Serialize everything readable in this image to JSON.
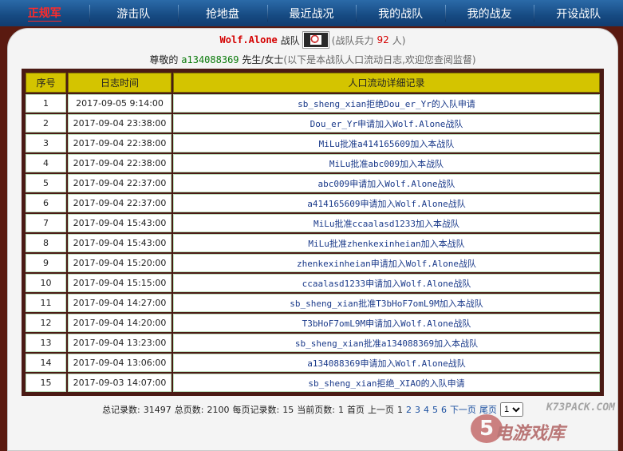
{
  "nav": {
    "items": [
      "正规军",
      "游击队",
      "抢地盘",
      "最近战况",
      "我的战队",
      "我的战友",
      "开设战队"
    ]
  },
  "header": {
    "team_name": "Wolf.Alone",
    "team_suffix": "战队",
    "power_label_pre": "(战队兵力",
    "power_value": "92",
    "power_label_post": "人)"
  },
  "intro": {
    "greeting": "尊敬的",
    "user": "a134088369",
    "title": "先生/女士",
    "note": "(以下是本战队人口流动日志,欢迎您查阅监督)"
  },
  "table": {
    "headers": [
      "序号",
      "日志时间",
      "人口流动详细记录"
    ],
    "rows": [
      {
        "no": "1",
        "time": "2017-09-05  9:14:00",
        "record": "sb_sheng_xian拒绝Dou_er_Yr的入队申请"
      },
      {
        "no": "2",
        "time": "2017-09-04 23:38:00",
        "record": "Dou_er_Yr申请加入Wolf.Alone战队"
      },
      {
        "no": "3",
        "time": "2017-09-04 22:38:00",
        "record": "MiLu批准a414165609加入本战队"
      },
      {
        "no": "4",
        "time": "2017-09-04 22:38:00",
        "record": "MiLu批准abc009加入本战队"
      },
      {
        "no": "5",
        "time": "2017-09-04 22:37:00",
        "record": "abc009申请加入Wolf.Alone战队"
      },
      {
        "no": "6",
        "time": "2017-09-04 22:37:00",
        "record": "a414165609申请加入Wolf.Alone战队"
      },
      {
        "no": "7",
        "time": "2017-09-04 15:43:00",
        "record": "MiLu批准ccaalasd1233加入本战队"
      },
      {
        "no": "8",
        "time": "2017-09-04 15:43:00",
        "record": "MiLu批准zhenkexinheian加入本战队"
      },
      {
        "no": "9",
        "time": "2017-09-04 15:20:00",
        "record": "zhenkexinheian申请加入Wolf.Alone战队"
      },
      {
        "no": "10",
        "time": "2017-09-04 15:15:00",
        "record": "ccaalasd1233申请加入Wolf.Alone战队"
      },
      {
        "no": "11",
        "time": "2017-09-04 14:27:00",
        "record": "sb_sheng_xian批准T3bHoF7omL9M加入本战队"
      },
      {
        "no": "12",
        "time": "2017-09-04 14:20:00",
        "record": "T3bHoF7omL9M申请加入Wolf.Alone战队"
      },
      {
        "no": "13",
        "time": "2017-09-04 13:23:00",
        "record": "sb_sheng_xian批准a134088369加入本战队"
      },
      {
        "no": "14",
        "time": "2017-09-04 13:06:00",
        "record": "a134088369申请加入Wolf.Alone战队"
      },
      {
        "no": "15",
        "time": "2017-09-03 14:07:00",
        "record": "sb_sheng_xian拒绝_XIAO的入队申请"
      }
    ]
  },
  "pager": {
    "total_label": "总记录数:",
    "total": "31497",
    "pages_label": "总页数:",
    "pages": "2100",
    "per_page_label": "每页记录数:",
    "per_page": "15",
    "current_label": "当前页数:",
    "current": "1",
    "first": "首页",
    "prev": "上一页",
    "page_links": [
      "1",
      "2",
      "3",
      "4",
      "5",
      "6"
    ],
    "next": "下一页",
    "last": "尾页",
    "select_value": "1"
  },
  "watermark": {
    "top": "K73PACK.COM",
    "mark": "5",
    "big": "电游戏库"
  },
  "colors": {
    "nav_bg": "#164a82",
    "frame": "#4a1a14",
    "header_cell": "#d4c400",
    "accent_red": "#d40000",
    "link_blue": "#1a3a8a"
  }
}
